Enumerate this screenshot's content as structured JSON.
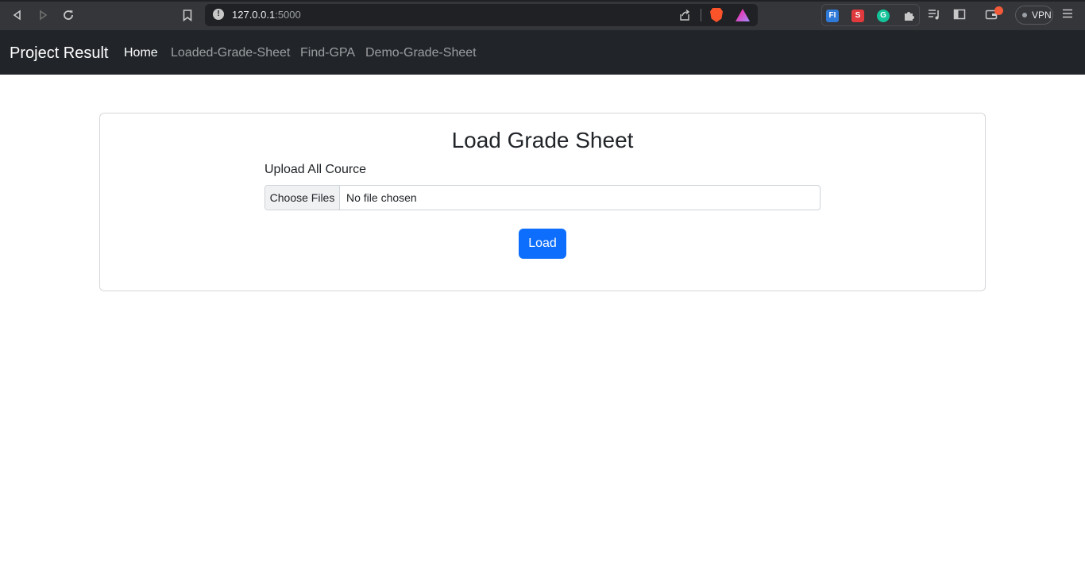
{
  "browser": {
    "address": {
      "host": "127.0.0.1",
      "port": ":5000"
    },
    "vpn_label": "VPN",
    "icons": {
      "back": "back-icon",
      "forward": "forward-icon",
      "reload": "reload-icon",
      "bookmark": "bookmark-icon",
      "site_info": "info-icon",
      "share": "share-icon",
      "brave": "brave-shield-icon",
      "rewards": "brave-rewards-icon",
      "extensions": [
        "fi-extension-icon",
        "red-extension-icon",
        "grammarly-icon",
        "puzzle-icon"
      ],
      "tools": [
        "playlist-icon",
        "sidebar-icon",
        "wallet-icon",
        "menu-icon"
      ]
    },
    "colors": {
      "chrome": "#35363a",
      "omnibox": "#202124",
      "notification": "#f05a38"
    }
  },
  "navbar": {
    "brand": "Project Result",
    "links": [
      {
        "label": "Home",
        "active": true
      },
      {
        "label": "Loaded-Grade-Sheet",
        "active": false
      },
      {
        "label": "Find-GPA",
        "active": false
      },
      {
        "label": "Demo-Grade-Sheet",
        "active": false
      }
    ],
    "colors": {
      "background": "#212529"
    }
  },
  "main": {
    "title": "Load Grade Sheet",
    "upload_label": "Upload All Cource",
    "file_input": {
      "button_label": "Choose Files",
      "status": "No file chosen"
    },
    "submit_label": "Load",
    "colors": {
      "primary": "#0d6efd"
    }
  }
}
